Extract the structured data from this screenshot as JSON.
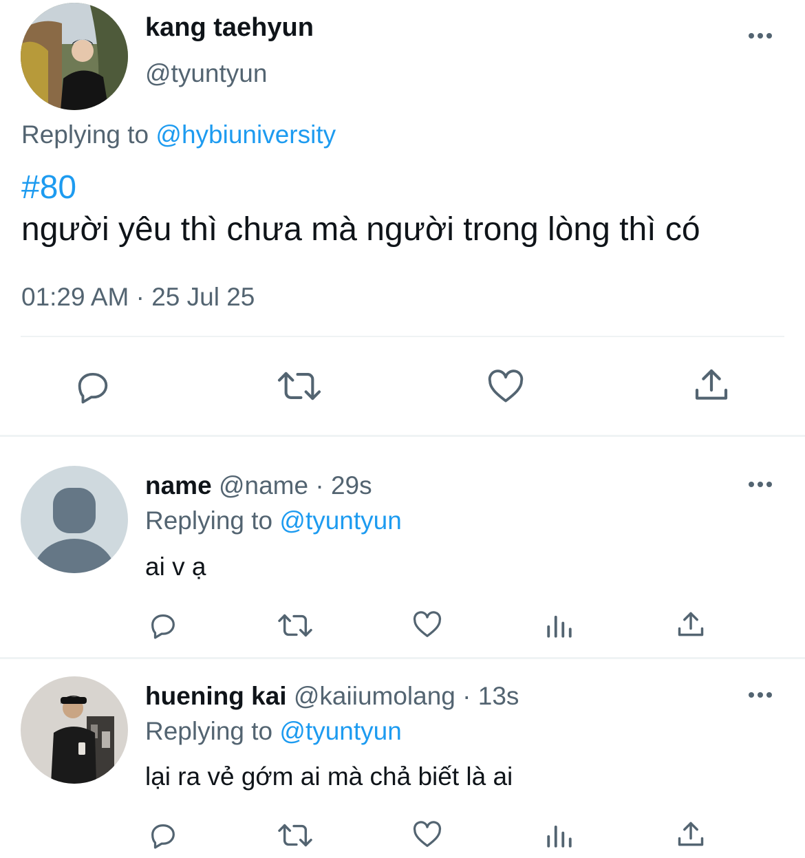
{
  "main_tweet": {
    "display_name": "kang taehyun",
    "handle": "@tyuntyun",
    "replying_prefix": "Replying to",
    "replying_handle": "@hybiuniversity",
    "hashtag": "#80",
    "text": "người yêu thì chưa mà người trong lòng thì có",
    "timestamp": "01:29 AM · 25 Jul 25"
  },
  "replies": [
    {
      "display_name": "name",
      "handle": "@name",
      "time": "· 29s",
      "replying_prefix": "Replying to",
      "replying_handle": "@tyuntyun",
      "text": "ai v ạ"
    },
    {
      "display_name": "huening kai",
      "handle": "@kaiiumolang",
      "time": "· 13s",
      "replying_prefix": "Replying to",
      "replying_handle": "@tyuntyun",
      "text": "lại ra vẻ gớm ai mà chả biết là ai"
    }
  ],
  "icons": {
    "reply": "reply-icon",
    "retweet": "retweet-icon",
    "like": "heart-icon",
    "views": "views-icon",
    "share": "share-icon",
    "more": "more-icon"
  },
  "colors": {
    "link": "#1d9bf0",
    "muted": "#536471",
    "text": "#0f1419",
    "divider": "#eff3f4"
  }
}
